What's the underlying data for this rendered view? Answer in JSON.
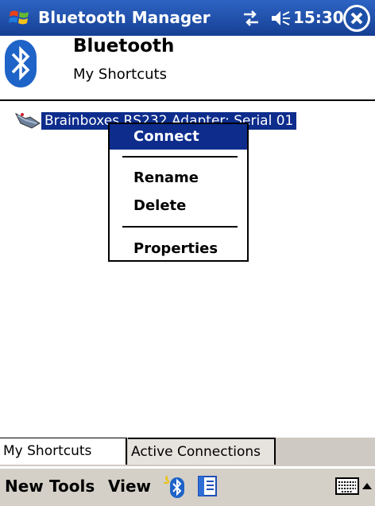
{
  "titlebar": {
    "title": "Bluetooth Manager",
    "time": "15:30"
  },
  "app": {
    "title": "Bluetooth",
    "subtitle": "My Shortcuts"
  },
  "shortcut": {
    "label": "Brainboxes RS232 Adapter: Serial 01"
  },
  "context_menu": {
    "items": [
      {
        "label": "Connect",
        "highlighted": true
      },
      {
        "label": "Rename"
      },
      {
        "label": "Delete"
      },
      {
        "label": "Properties"
      }
    ]
  },
  "tabs": [
    {
      "label": "My Shortcuts",
      "active": true
    },
    {
      "label": "Active Connections",
      "active": false
    }
  ],
  "menubar": {
    "new": "New",
    "tools": "Tools",
    "view": "View"
  },
  "colors": {
    "titlebar": "#1c4fa8",
    "selection": "#0d2c8c",
    "bar": "#d4d0c8"
  },
  "icons": [
    "windows-start-icon",
    "connectivity-icon",
    "volume-icon",
    "close-icon",
    "bluetooth-icon",
    "device-icon",
    "bluetooth-menu-icon",
    "contacts-icon",
    "keyboard-icon"
  ]
}
